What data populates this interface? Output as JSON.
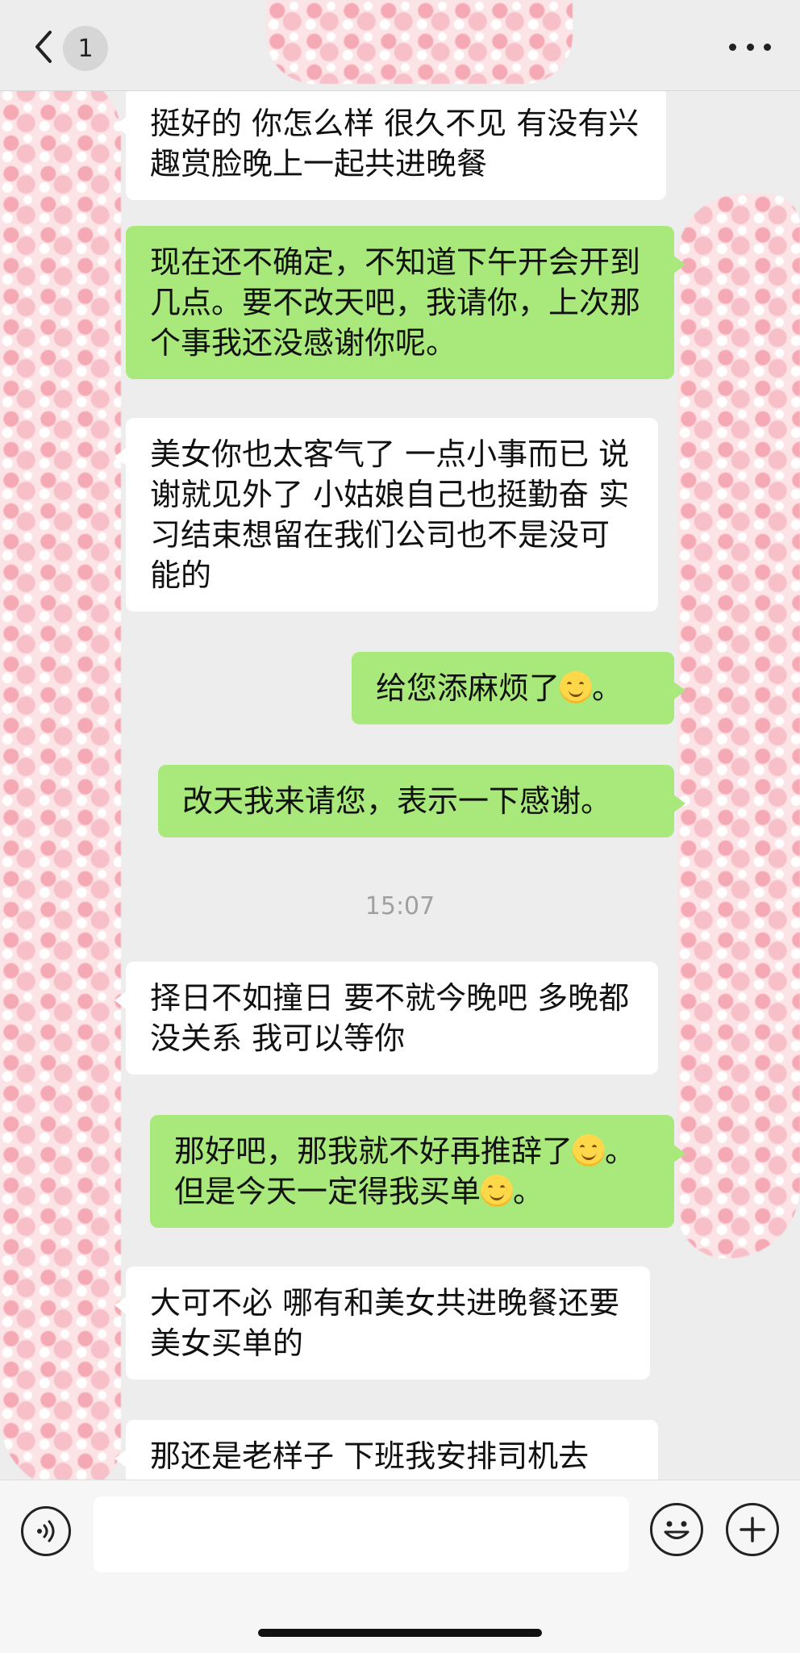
{
  "header": {
    "unread_count": "1",
    "icons": {
      "back": "chevron-left-icon",
      "more": "more-dots-icon"
    }
  },
  "messages": [
    {
      "side": "incoming",
      "text": "挺好的 你怎么样 很久不见 有没有兴趣赏脸晚上一起共进晚餐"
    },
    {
      "side": "outgoing",
      "text": "现在还不确定，不知道下午开会开到几点。要不改天吧，我请你，上次那个事我还没感谢你呢。"
    },
    {
      "side": "incoming",
      "text": "美女你也太客气了 一点小事而已 说谢就见外了 小姑娘自己也挺勤奋 实习结束想留在我们公司也不是没可能的"
    },
    {
      "side": "outgoing",
      "text_before": "给您添麻烦了",
      "text_after": "。",
      "emoji": "smiling-face-icon"
    },
    {
      "side": "outgoing",
      "text": "改天我来请您，表示一下感谢。"
    },
    {
      "side": "incoming",
      "text": "择日不如撞日 要不就今晚吧 多晚都没关系 我可以等你"
    },
    {
      "side": "outgoing",
      "text_part1": "那好吧，那我就不好再推辞了",
      "text_part2": "。但是今天一定得我买单",
      "text_part3": "。",
      "emoji": "smiling-face-icon"
    },
    {
      "side": "incoming",
      "text": "大可不必 哪有和美女共进晚餐还要美女买单的"
    },
    {
      "side": "incoming",
      "text": "那还是老样子 下班我安排司机去"
    }
  ],
  "timestamp": "15:07",
  "input_bar": {
    "value": "",
    "icons": {
      "voice": "voice-icon",
      "emoji": "emoji-icon",
      "plus": "plus-icon"
    }
  },
  "colors": {
    "background": "#ededed",
    "incoming_bubble": "#ffffff",
    "outgoing_bubble": "#a9e87b",
    "timestamp": "#a0a0a0",
    "censor_hearts": "#f4a9b5"
  }
}
